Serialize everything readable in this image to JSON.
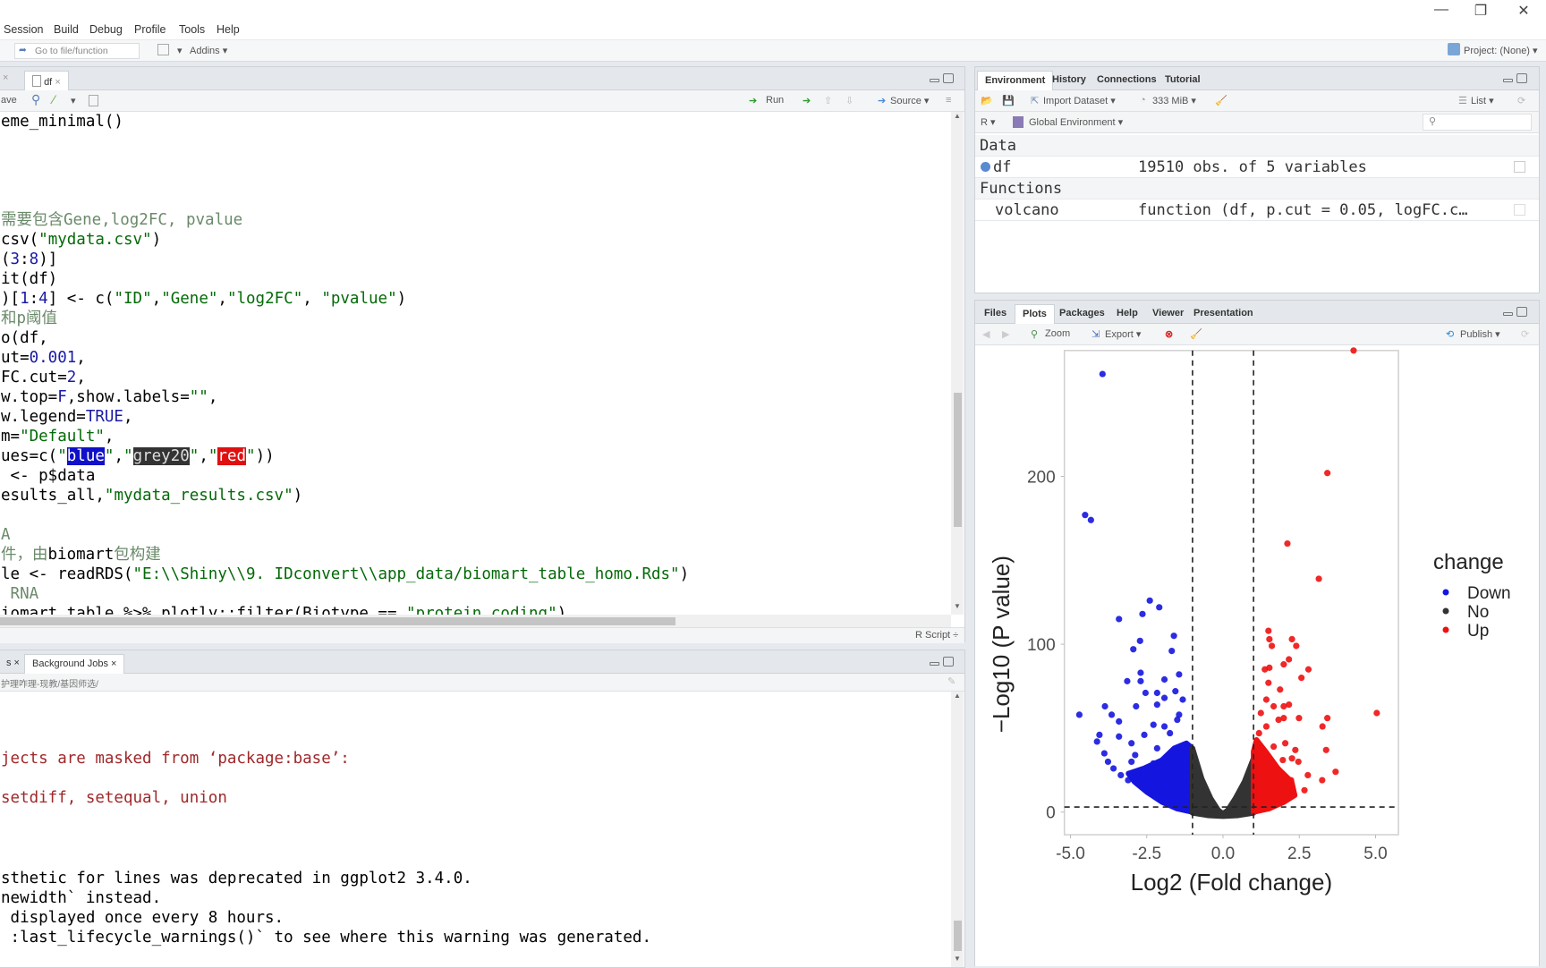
{
  "window": {
    "minimize": "—",
    "maximize": "❐",
    "close": "✕"
  },
  "menu": [
    "Session",
    "Build",
    "Debug",
    "Profile",
    "Tools",
    "Help"
  ],
  "toolbar": {
    "goto_placeholder": "Go to file/function",
    "addins": "Addins ▾",
    "project": "Project: (None) ▾"
  },
  "source": {
    "tab_label": "df",
    "tab_close": "×",
    "save_fragment": "ave",
    "run_label": "Run",
    "source_label": "Source ▾",
    "status_label": "R Script ÷",
    "lines": [
      [
        [
          "t",
          "eme_minimal()"
        ]
      ],
      [],
      [],
      [],
      [],
      [
        [
          "c",
          "需要包含"
        ],
        [
          "c",
          "Gene,log2FC, pvalue"
        ]
      ],
      [
        [
          "t",
          "csv("
        ],
        [
          "s",
          "\"mydata.csv\""
        ],
        [
          "t",
          ")"
        ]
      ],
      [
        [
          "t",
          "("
        ],
        [
          "n",
          "3"
        ],
        [
          "t",
          ":"
        ],
        [
          "n",
          "8"
        ],
        [
          "t",
          ")]"
        ]
      ],
      [
        [
          "t",
          "it(df)"
        ]
      ],
      [
        [
          "t",
          ")["
        ],
        [
          "n",
          "1"
        ],
        [
          "t",
          ":"
        ],
        [
          "n",
          "4"
        ],
        [
          "t",
          "] <- c("
        ],
        [
          "s",
          "\"ID\""
        ],
        [
          "t",
          ","
        ],
        [
          "s",
          "\"Gene\""
        ],
        [
          "t",
          ","
        ],
        [
          "s",
          "\"log2FC\""
        ],
        [
          "t",
          ", "
        ],
        [
          "s",
          "\"pvalue\""
        ],
        [
          "t",
          ")"
        ]
      ],
      [
        [
          "c",
          "和p阈值"
        ]
      ],
      [
        [
          "t",
          "o(df,"
        ]
      ],
      [
        [
          "t",
          "ut="
        ],
        [
          "n",
          "0.001"
        ],
        [
          "t",
          ","
        ]
      ],
      [
        [
          "t",
          "FC.cut="
        ],
        [
          "n",
          "2"
        ],
        [
          "t",
          ","
        ]
      ],
      [
        [
          "t",
          "w.top="
        ],
        [
          "k",
          "F"
        ],
        [
          "t",
          ",show.labels="
        ],
        [
          "s",
          "\"\""
        ],
        [
          "t",
          ","
        ]
      ],
      [
        [
          "t",
          "w.legend="
        ],
        [
          "k",
          "TRUE"
        ],
        [
          "t",
          ","
        ]
      ],
      [
        [
          "t",
          "m="
        ],
        [
          "s",
          "\"Default\""
        ],
        [
          "t",
          ","
        ]
      ],
      [
        [
          "t",
          "ues=c("
        ],
        [
          "s",
          "\""
        ],
        [
          "hb",
          "blue"
        ],
        [
          "s",
          "\""
        ],
        [
          "t",
          ","
        ],
        [
          "s",
          "\""
        ],
        [
          "hg",
          "grey20"
        ],
        [
          "s",
          "\""
        ],
        [
          "t",
          ","
        ],
        [
          "s",
          "\""
        ],
        [
          "hr",
          "red"
        ],
        [
          "s",
          "\""
        ],
        [
          "t",
          "))"
        ]
      ],
      [
        [
          "t",
          " <- p$data"
        ]
      ],
      [
        [
          "t",
          "esults_all,"
        ],
        [
          "s",
          "\"mydata_results.csv\""
        ],
        [
          "t",
          ")"
        ]
      ],
      [],
      [
        [
          "c",
          "A"
        ]
      ],
      [
        [
          "c",
          "件，由"
        ],
        [
          "t",
          "biomart"
        ],
        [
          "c",
          "包构建"
        ]
      ],
      [
        [
          "t",
          "le <- readRDS("
        ],
        [
          "s",
          "\"E:\\\\Shiny\\\\9. IDconvert\\\\app_data/biomart_table_homo.Rds\""
        ],
        [
          "t",
          ")"
        ]
      ],
      [
        [
          "c",
          " RNA"
        ]
      ],
      [
        [
          "t",
          "iomart_table %>% plotly::filter(Biotype == "
        ],
        [
          "s",
          "\"protein_coding\""
        ],
        [
          "t",
          ")"
        ]
      ]
    ]
  },
  "console": {
    "tabs": [
      {
        "label": "s ×"
      },
      {
        "label": "Background Jobs ×"
      }
    ],
    "path": "护理咋理-现教/基因师选/",
    "lines": [
      {
        "cls": "cr",
        "text": "jects are masked from ‘package:base’:"
      },
      {
        "cls": "cr",
        "text": "setdiff, setequal, union"
      },
      {
        "cls": "cb",
        "text": "sthetic for lines was deprecated in ggplot2 3.4.0."
      },
      {
        "cls": "cb",
        "text": "newidth` instead."
      },
      {
        "cls": "cb",
        "text": " displayed once every 8 hours."
      },
      {
        "cls": "cb",
        "text": " :last_lifecycle_warnings()` to see where this warning was generated."
      }
    ]
  },
  "environment": {
    "tabs": [
      "Environment",
      "History",
      "Connections",
      "Tutorial"
    ],
    "import_label": "Import Dataset ▾",
    "memory_label": "333 MiB ▾",
    "list_label": "List ▾",
    "lang_label": "R ▾",
    "scope_label": "Global Environment ▾",
    "data_header": "Data",
    "functions_header": "Functions",
    "data_rows": [
      {
        "name": "df",
        "value": "19510 obs. of 5 variables"
      }
    ],
    "function_rows": [
      {
        "name": "volcano",
        "value": "function (df, p.cut = 0.05, logFC.c…"
      }
    ]
  },
  "files": {
    "tabs": [
      "Files",
      "Plots",
      "Packages",
      "Help",
      "Viewer",
      "Presentation"
    ],
    "zoom_label": "Zoom",
    "export_label": "Export ▾",
    "publish_label": "Publish ▾"
  },
  "colors": {
    "Down": "#1515e0",
    "No": "#333333",
    "Up": "#ee1111"
  },
  "chart_data": {
    "type": "scatter",
    "xlabel": "Log2 (Fold change)",
    "ylabel": "−Log10 (P value)",
    "xlim": [
      -5.2,
      5.75
    ],
    "ylim": [
      -13.5,
      275
    ],
    "xticks": [
      -5.0,
      -2.5,
      0.0,
      2.5,
      5.0
    ],
    "xtick_labels": [
      "-5.0",
      "-2.5",
      "0.0",
      "2.5",
      "5.0"
    ],
    "yticks": [
      0,
      100,
      200
    ],
    "ytick_labels": [
      "0",
      "100",
      "200"
    ],
    "vlines": [
      -1,
      1
    ],
    "hline": 3,
    "grid": false,
    "legend": {
      "title": "change",
      "placement": "right",
      "entries": [
        "Down",
        "No",
        "Up"
      ]
    },
    "dense_envelopes": {
      "Down": [
        [
          -1,
          0
        ],
        [
          -1.5,
          2
        ],
        [
          -2,
          6
        ],
        [
          -2.5,
          12
        ],
        [
          -2.9,
          18
        ],
        [
          -3.1,
          23
        ],
        [
          -2.6,
          26
        ],
        [
          -2.0,
          31
        ],
        [
          -1.6,
          38
        ],
        [
          -1.2,
          41
        ],
        [
          -1,
          38
        ]
      ],
      "No": [
        [
          -1,
          -0.5
        ],
        [
          -0.5,
          -2
        ],
        [
          0,
          -2.5
        ],
        [
          0.5,
          -2
        ],
        [
          1,
          -0.5
        ],
        [
          1,
          32
        ],
        [
          0.7,
          18
        ],
        [
          0.4,
          8
        ],
        [
          0.15,
          1
        ],
        [
          0,
          -1
        ],
        [
          -0.15,
          1
        ],
        [
          -0.4,
          8
        ],
        [
          -0.7,
          20
        ],
        [
          -1,
          38
        ]
      ],
      "Up": [
        [
          1,
          0
        ],
        [
          1.5,
          2
        ],
        [
          2.0,
          6
        ],
        [
          2.35,
          10
        ],
        [
          2.25,
          18
        ],
        [
          1.8,
          26
        ],
        [
          1.4,
          36
        ],
        [
          1.1,
          43
        ],
        [
          1,
          36
        ]
      ]
    },
    "series": [
      {
        "name": "Down",
        "points": [
          [
            -3.95,
            261
          ],
          [
            -4.52,
            177
          ],
          [
            -4.33,
            174
          ],
          [
            -2.4,
            126
          ],
          [
            -2.09,
            122
          ],
          [
            -2.64,
            118
          ],
          [
            -3.41,
            115
          ],
          [
            -1.61,
            105
          ],
          [
            -2.72,
            102
          ],
          [
            -2.94,
            97
          ],
          [
            -1.68,
            96
          ],
          [
            -2.7,
            83
          ],
          [
            -3.14,
            78
          ],
          [
            -2.7,
            78
          ],
          [
            -1.92,
            79
          ],
          [
            -1.44,
            82
          ],
          [
            -2.54,
            71
          ],
          [
            -2.16,
            71
          ],
          [
            -1.56,
            72
          ],
          [
            -3.87,
            63
          ],
          [
            -2.85,
            63
          ],
          [
            -2.16,
            64
          ],
          [
            -1.92,
            68
          ],
          [
            -4.71,
            58
          ],
          [
            -3.65,
            58
          ],
          [
            -3.41,
            54
          ],
          [
            -2.28,
            52
          ],
          [
            -1.92,
            51
          ],
          [
            -1.5,
            55
          ],
          [
            -4.05,
            46
          ],
          [
            -4.13,
            42
          ],
          [
            -3.41,
            45
          ],
          [
            -3.0,
            41
          ],
          [
            -2.58,
            46
          ],
          [
            -2.88,
            34
          ],
          [
            -3.89,
            35
          ],
          [
            -3.59,
            26
          ],
          [
            -3.77,
            30
          ],
          [
            -3.35,
            22
          ],
          [
            -3.11,
            19
          ],
          [
            -3.0,
            30
          ],
          [
            -2.28,
            29
          ],
          [
            -1.92,
            30
          ],
          [
            -1.44,
            58
          ],
          [
            -1.32,
            67
          ],
          [
            -1.74,
            47
          ],
          [
            -1.2,
            38
          ],
          [
            -2.16,
            38
          ]
        ]
      },
      {
        "name": "Up",
        "points": [
          [
            4.28,
            275
          ],
          [
            3.42,
            202
          ],
          [
            2.11,
            160
          ],
          [
            3.14,
            139
          ],
          [
            1.49,
            108
          ],
          [
            2.26,
            103
          ],
          [
            1.52,
            103
          ],
          [
            2.4,
            99
          ],
          [
            1.6,
            99
          ],
          [
            2.16,
            91
          ],
          [
            1.99,
            88
          ],
          [
            2.8,
            85
          ],
          [
            1.37,
            85
          ],
          [
            1.52,
            86
          ],
          [
            2.57,
            80
          ],
          [
            1.49,
            77
          ],
          [
            1.87,
            73
          ],
          [
            5.04,
            59
          ],
          [
            3.42,
            56
          ],
          [
            3.26,
            51
          ],
          [
            2.49,
            56
          ],
          [
            1.99,
            56
          ],
          [
            2.16,
            64
          ],
          [
            1.99,
            63
          ],
          [
            1.66,
            63
          ],
          [
            1.42,
            67
          ],
          [
            1.24,
            59
          ],
          [
            1.82,
            55
          ],
          [
            3.38,
            37
          ],
          [
            3.69,
            24
          ],
          [
            3.25,
            19
          ],
          [
            2.78,
            22
          ],
          [
            2.47,
            30
          ],
          [
            2.37,
            37
          ],
          [
            2.04,
            41
          ],
          [
            1.66,
            39
          ],
          [
            1.18,
            47
          ],
          [
            1.42,
            51
          ],
          [
            2.67,
            13
          ],
          [
            2.23,
            19
          ],
          [
            1.96,
            31
          ],
          [
            2.26,
            32
          ]
        ]
      }
    ]
  }
}
